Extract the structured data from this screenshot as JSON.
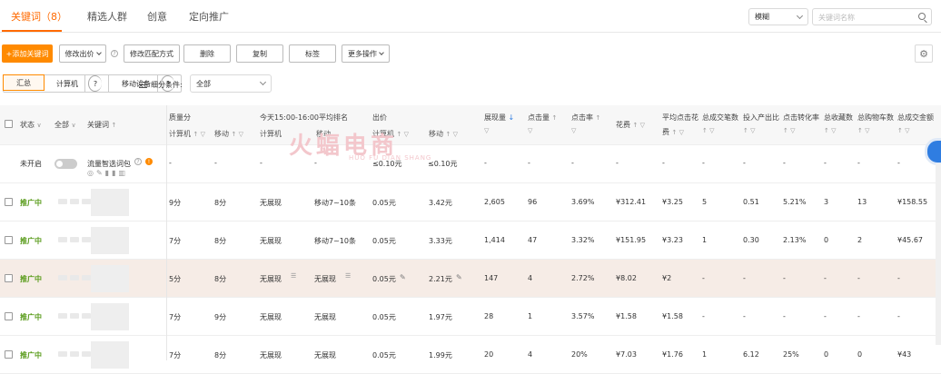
{
  "tabs": [
    {
      "label": "关键词（8）",
      "active": true
    },
    {
      "label": "精选人群"
    },
    {
      "label": "创意"
    },
    {
      "label": "定向推广"
    }
  ],
  "search": {
    "mode": "模糊",
    "placeholder": "关键词名称"
  },
  "toolbar": {
    "add": "+添加关键词",
    "modify_bid": "修改出价",
    "modify_match": "修改匹配方式",
    "delete": "删除",
    "copy": "复制",
    "tag": "标签",
    "more": "更多操作"
  },
  "views": [
    "汇总",
    "计算机",
    "移动设备"
  ],
  "filter": {
    "label": "细分条件:",
    "value": "全部"
  },
  "header": {
    "status": "状态",
    "all": "全部",
    "keyword": "关键词",
    "quality": "质量分",
    "quality_pc": "计算机",
    "quality_mobile": "移动",
    "rank": "今天15:00-16:00平均排名",
    "rank_pc": "计算机",
    "rank_mobile": "移动",
    "bid": "出价",
    "bid_pc": "计算机",
    "bid_mobile": "移动",
    "impressions": "展现量",
    "clicks": "点击量",
    "ctr": "点击率",
    "cost": "花费",
    "avg_cpc_1": "平均点击花",
    "avg_cpc_2": "费",
    "conv": "总成交笔数",
    "roi": "投入产出比",
    "cvr": "点击转化率",
    "fav": "总收藏数",
    "cart": "总购物车数",
    "gmv": "总成交金额"
  },
  "package_row": {
    "status": "未开启",
    "name": "流量智选词包",
    "quality_pc": "-",
    "quality_mobile": "-",
    "rank_pc": "-",
    "rank_mobile": "-",
    "bid_pc": "≤0.10元",
    "bid_mobile": "≤0.10元",
    "impressions": "-",
    "clicks": "-",
    "ctr": "-",
    "cost": "-",
    "cpc": "-",
    "conv": "-",
    "roi": "-",
    "cvr": "-",
    "fav": "-",
    "cart": "-",
    "gmv": "-"
  },
  "rows": [
    {
      "status": "推广中",
      "q_pc": "9分",
      "q_m": "8分",
      "r_pc": "无展现",
      "r_m": "移动7~10条",
      "b_pc": "0.05元",
      "b_m": "3.42元",
      "imp": "2,605",
      "clk": "96",
      "ctr": "3.69%",
      "cost": "¥312.41",
      "cpc": "¥3.25",
      "conv": "5",
      "roi": "0.51",
      "cvr": "5.21%",
      "fav": "3",
      "cart": "13",
      "gmv": "¥158.55"
    },
    {
      "status": "推广中",
      "q_pc": "7分",
      "q_m": "8分",
      "r_pc": "无展现",
      "r_m": "移动7~10条",
      "b_pc": "0.05元",
      "b_m": "3.33元",
      "imp": "1,414",
      "clk": "47",
      "ctr": "3.32%",
      "cost": "¥151.95",
      "cpc": "¥3.23",
      "conv": "1",
      "roi": "0.30",
      "cvr": "2.13%",
      "fav": "0",
      "cart": "2",
      "gmv": "¥45.67"
    },
    {
      "status": "推广中",
      "q_pc": "5分",
      "q_m": "8分",
      "r_pc": "无展现",
      "r_m": "无展现",
      "b_pc": "0.05元",
      "b_m": "2.21元",
      "imp": "147",
      "clk": "4",
      "ctr": "2.72%",
      "cost": "¥8.02",
      "cpc": "¥2",
      "conv": "-",
      "roi": "-",
      "cvr": "-",
      "fav": "-",
      "cart": "-",
      "gmv": "-"
    },
    {
      "status": "推广中",
      "q_pc": "7分",
      "q_m": "9分",
      "r_pc": "无展现",
      "r_m": "无展现",
      "b_pc": "0.05元",
      "b_m": "1.97元",
      "imp": "28",
      "clk": "1",
      "ctr": "3.57%",
      "cost": "¥1.58",
      "cpc": "¥1.58",
      "conv": "-",
      "roi": "-",
      "cvr": "-",
      "fav": "-",
      "cart": "-",
      "gmv": "-"
    },
    {
      "status": "推广中",
      "q_pc": "7分",
      "q_m": "8分",
      "r_pc": "无展现",
      "r_m": "无展现",
      "b_pc": "0.05元",
      "b_m": "1.99元",
      "imp": "20",
      "clk": "4",
      "ctr": "20%",
      "cost": "¥7.03",
      "cpc": "¥1.76",
      "conv": "1",
      "roi": "6.12",
      "cvr": "25%",
      "fav": "0",
      "cart": "0",
      "gmv": "¥43"
    }
  ],
  "watermark": {
    "brand": "火蝠电商",
    "sub": "HUO FU DIAN SHANG"
  },
  "colors": {
    "accent": "#ff6a00",
    "status_green": "#5a9c1c"
  }
}
